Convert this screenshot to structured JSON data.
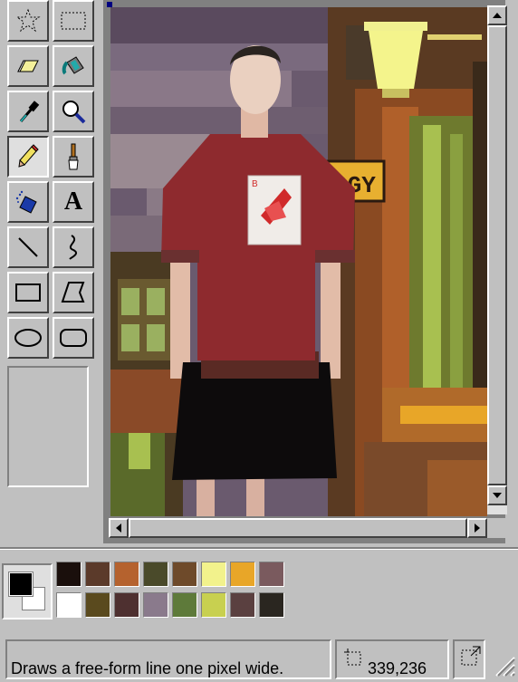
{
  "toolbox": {
    "tools": [
      {
        "name": "free-form-select",
        "icon": "star-select-icon",
        "selected": false
      },
      {
        "name": "select",
        "icon": "rect-select-icon",
        "selected": false
      },
      {
        "name": "eraser",
        "icon": "eraser-icon",
        "selected": false
      },
      {
        "name": "fill-with-color",
        "icon": "paint-bucket-icon",
        "selected": false
      },
      {
        "name": "pick-color",
        "icon": "eyedropper-icon",
        "selected": false
      },
      {
        "name": "magnifier",
        "icon": "magnifier-icon",
        "selected": false
      },
      {
        "name": "pencil",
        "icon": "pencil-icon",
        "selected": true
      },
      {
        "name": "brush",
        "icon": "brush-icon",
        "selected": false
      },
      {
        "name": "airbrush",
        "icon": "airbrush-icon",
        "selected": false
      },
      {
        "name": "text",
        "icon": "text-icon",
        "selected": false
      },
      {
        "name": "line",
        "icon": "line-icon",
        "selected": false
      },
      {
        "name": "curve",
        "icon": "curve-icon",
        "selected": false
      },
      {
        "name": "rectangle",
        "icon": "rectangle-icon",
        "selected": false
      },
      {
        "name": "polygon",
        "icon": "polygon-icon",
        "selected": false
      },
      {
        "name": "ellipse",
        "icon": "ellipse-icon",
        "selected": false
      },
      {
        "name": "rounded-rectangle",
        "icon": "rounded-rect-icon",
        "selected": false
      }
    ],
    "text_tool_glyph": "A"
  },
  "palette": {
    "foreground": "#000000",
    "background": "#ffffff",
    "row1": [
      "#1a0f0c",
      "#5b3a2a",
      "#b5622e",
      "#4a4a2a",
      "#6e4a2a",
      "#f2f28c",
      "#e8a628",
      "#7a5a5e"
    ],
    "row2": [
      "#ffffff",
      "#5a4a1e",
      "#4e3030",
      "#8a7a8c",
      "#5e7a3a",
      "#c8d050",
      "#5a4040",
      "#2a2620"
    ]
  },
  "canvas": {
    "sign_text": "GGY",
    "card_corner": "B"
  },
  "status": {
    "help_text": "Draws a free-form line one pixel wide.",
    "coordinates": "339,236"
  },
  "colors": {
    "ui_face": "#c0c0c0",
    "canvas_bg": "#808080",
    "shirt": "#8e2a2e",
    "skirt": "#0d0b0c"
  }
}
